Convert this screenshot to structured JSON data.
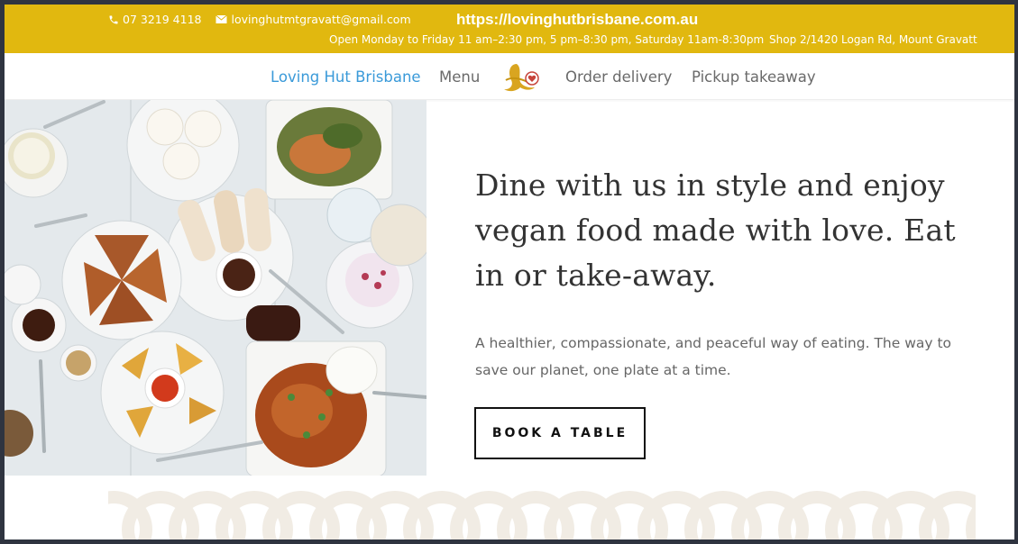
{
  "topbar": {
    "phone": "07 3219 4118",
    "email": "lovinghutmtgravatt@gmail.com",
    "url": "https://lovinghutbrisbane.com.au",
    "hours": "Open Monday to Friday 11 am–2:30 pm, 5 pm–8:30 pm, Saturday 11am-8:30pm",
    "address": "Shop 2/1420 Logan Rd, Mount Gravatt",
    "bg_color": "#e1b80f"
  },
  "nav": {
    "items": [
      {
        "label": "Loving Hut Brisbane",
        "active": true
      },
      {
        "label": "Menu",
        "active": false
      },
      {
        "label": "Order delivery",
        "active": false
      },
      {
        "label": "Pickup takeaway",
        "active": false
      }
    ],
    "active_color": "#3a9ad9"
  },
  "hero": {
    "headline": "Dine with us in style and enjoy vegan food made with love. Eat in or take-away.",
    "subtext": "A healthier, compassionate, and peaceful way of eating. The way to save our planet, one plate at a time.",
    "button_label": "BOOK A TABLE"
  }
}
